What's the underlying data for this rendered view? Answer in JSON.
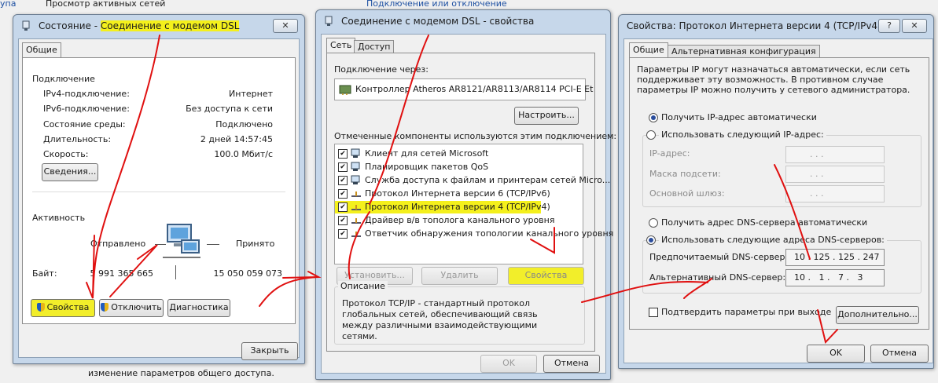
{
  "background": {
    "line1": "Просмотр активных сетей",
    "link1": "Подключение или отключение",
    "bottom_text": "изменение параметров общего доступа.",
    "left_edge": "упа"
  },
  "status_dialog": {
    "title_prefix": "Состояние - ",
    "title_highlight": "Соединение с модемом DSL",
    "close_glyph": "✕",
    "tab": "Общие",
    "connection_header": "Подключение",
    "rows": [
      {
        "label": "IPv4-подключение:",
        "value": "Интернет"
      },
      {
        "label": "IPv6-подключение:",
        "value": "Без доступа к сети"
      },
      {
        "label": "Состояние среды:",
        "value": "Подключено"
      },
      {
        "label": "Длительность:",
        "value": "2 дней 14:57:45"
      },
      {
        "label": "Скорость:",
        "value": "100.0 Мбит/с"
      }
    ],
    "details_button": "Сведения...",
    "activity_header": "Активность",
    "sent_label": "Отправлено",
    "received_label": "Принято",
    "bytes_label": "Байт:",
    "bytes_sent": "5 991 365 665",
    "bytes_received": "15 050 059 073",
    "properties_button": "Свойства",
    "disconnect_button": "Отключить",
    "diagnostics_button": "Диагностика",
    "close_button": "Закрыть"
  },
  "props_dialog": {
    "title": "Соединение с модемом DSL - свойства",
    "tabs": [
      "Сеть",
      "Доступ"
    ],
    "connect_via_label": "Подключение через:",
    "adapter": "Контроллер Atheros AR8121/AR8113/AR8114 PCI-E Et",
    "configure_button": "Настроить...",
    "components_label": "Отмеченные компоненты используются этим подключением:",
    "components": [
      {
        "label": "Клиент для сетей Microsoft",
        "checked": true,
        "icon": "network-client-icon"
      },
      {
        "label": "Планировщик пакетов QoS",
        "checked": true,
        "icon": "qos-icon"
      },
      {
        "label": "Служба доступа к файлам и принтерам сетей Micro...",
        "checked": true,
        "icon": "printer-icon"
      },
      {
        "label": "Протокол Интернета версии 6 (TCP/IPv6)",
        "checked": true,
        "icon": "protocol-icon"
      },
      {
        "label": "Протокол Интернета версии 4 (TCP/IPv4)",
        "checked": true,
        "icon": "protocol-icon",
        "highlighted": true
      },
      {
        "label": "Драйвер в/в тополога канального уровня",
        "checked": true,
        "icon": "protocol-icon"
      },
      {
        "label": "Ответчик обнаружения топологии канального уровня",
        "checked": true,
        "icon": "protocol-icon"
      }
    ],
    "check_glyph": "✔",
    "install_button": "Установить...",
    "remove_button": "Удалить",
    "properties_button": "Свойства",
    "description_header": "Описание",
    "description": "Протокол TCP/IP - стандартный протокол глобальных сетей, обеспечивающий связь между различными взаимодействующими сетями.",
    "ok_button": "OK",
    "cancel_button": "Отмена"
  },
  "ipv4_dialog": {
    "title": "Свойства: Протокол Интернета версии 4 (TCP/IPv4)",
    "help_glyph": "?",
    "close_glyph": "✕",
    "tabs": [
      "Общие",
      "Альтернативная конфигурация"
    ],
    "intro": "Параметры IP могут назначаться автоматически, если сеть поддерживает эту возможность. В противном случае параметры IP можно получить у сетевого администратора.",
    "auto_ip": "Получить IP-адрес автоматически",
    "manual_ip": "Использовать следующий IP-адрес:",
    "ip_label": "IP-адрес:",
    "mask_label": "Маска подсети:",
    "gateway_label": "Основной шлюз:",
    "empty_ip": ".       .       .",
    "auto_dns": "Получить адрес DNS-сервера автоматически",
    "manual_dns": "Использовать следующие адреса DNS-серверов:",
    "preferred_dns_label": "Предпочитаемый DNS-сервер:",
    "preferred_dns": "10 . 125 . 125 . 247",
    "alternate_dns_label": "Альтернативный DNS-сервер:",
    "alternate_dns": "10 .   1 .   7 .   3",
    "validate_label": "Подтвердить параметры при выходе",
    "advanced_button": "Дополнительно...",
    "ok_button": "OK",
    "cancel_button": "Отмена"
  },
  "colors": {
    "highlight": "#f4f01c",
    "arrow": "#e01010",
    "link": "#1e50a2"
  }
}
